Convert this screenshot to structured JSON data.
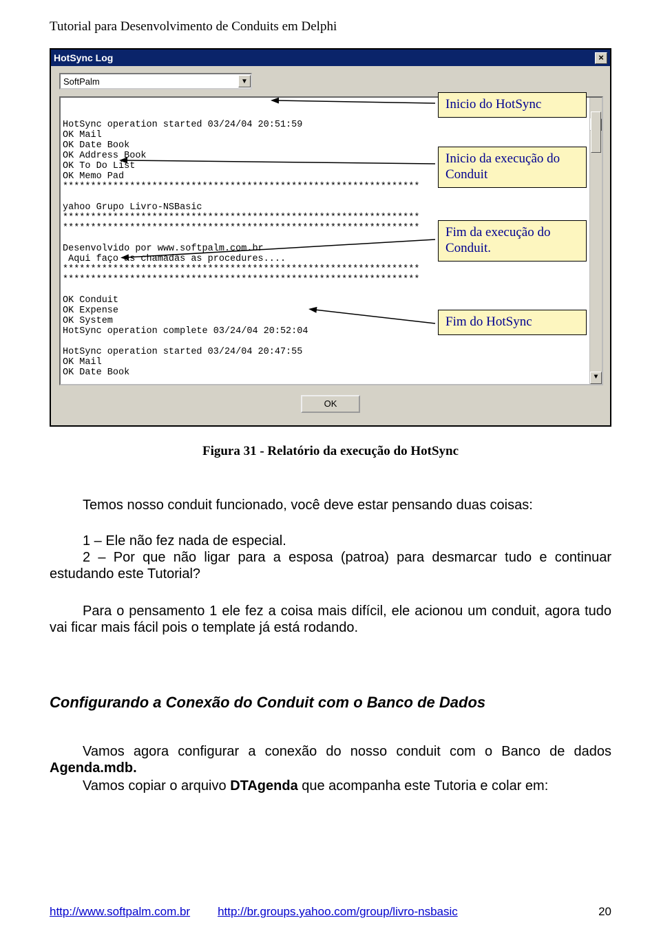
{
  "page_header": "Tutorial para Desenvolvimento de Conduits em Delphi",
  "dialog": {
    "title": "HotSync Log",
    "close_label": "×",
    "combo_value": "SoftPalm",
    "ok_label": "OK",
    "log_lines": [
      "HotSync operation started 03/24/04 20:51:59",
      "OK Mail",
      "OK Date Book",
      "OK Address Book",
      "OK To Do List",
      "OK Memo Pad",
      "****************************************************************",
      "",
      "yahoo Grupo Livro-NSBasic",
      "****************************************************************",
      "****************************************************************",
      "",
      "Desenvolvido por www.softpalm.com.br",
      " Aqui faço as chamadas as procedures....",
      "****************************************************************",
      "****************************************************************",
      "",
      "OK Conduit",
      "OK Expense",
      "OK System",
      "HotSync operation complete 03/24/04 20:52:04",
      "",
      "HotSync operation started 03/24/04 20:47:55",
      "OK Mail",
      "OK Date Book"
    ]
  },
  "callouts": {
    "c1": "Inicio do HotSync",
    "c2": "Inicio da execução do Conduit",
    "c3": "Fim da execução do Conduit.",
    "c4": "Fim do HotSync"
  },
  "figure_caption": "Figura 31 - Relatório da execução do HotSync",
  "paragraphs": {
    "p1": "Temos nosso conduit funcionado, você deve estar pensando duas coisas:",
    "l1": "1 – Ele não fez nada de especial.",
    "l2": "2 – Por que não ligar para a esposa (patroa) para desmarcar tudo e continuar estudando este Tutorial?",
    "p2": "Para o pensamento 1 ele fez a coisa mais difícil, ele acionou um conduit, agora tudo vai ficar mais fácil pois o template já está rodando.",
    "heading": "Configurando a Conexão do Conduit com o Banco de Dados",
    "p3a": "Vamos agora configurar a conexão do nosso conduit com o  Banco de dados ",
    "p3b": "Agenda.mdb.",
    "p4a": "Vamos copiar o arquivo ",
    "p4b": "DTAgenda",
    "p4c": " que acompanha este Tutoria e colar em:"
  },
  "footer": {
    "link1": "http://www.softpalm.com.br",
    "link2": "http://br.groups.yahoo.com/group/livro-nsbasic",
    "page": "20"
  }
}
